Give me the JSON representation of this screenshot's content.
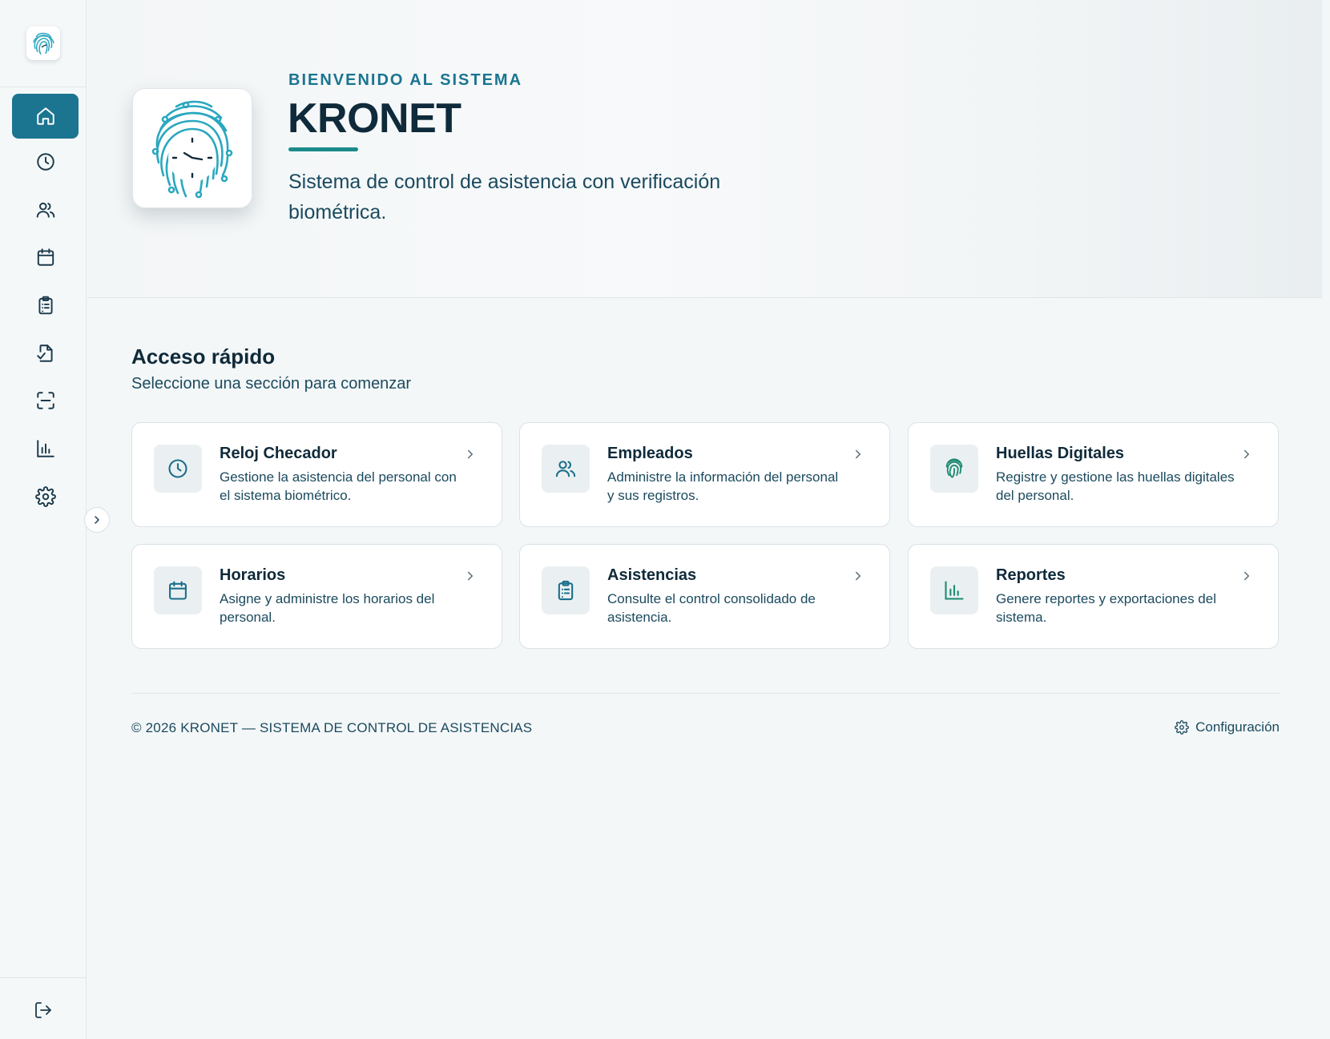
{
  "sidebar": {
    "items": [
      {
        "name": "home-icon",
        "active": true
      },
      {
        "name": "clock-icon",
        "active": false
      },
      {
        "name": "users-icon",
        "active": false
      },
      {
        "name": "calendar-icon",
        "active": false
      },
      {
        "name": "clipboard-icon",
        "active": false
      },
      {
        "name": "file-check-icon",
        "active": false
      },
      {
        "name": "scan-icon",
        "active": false
      },
      {
        "name": "bar-chart-icon",
        "active": false
      },
      {
        "name": "gear-icon",
        "active": false
      }
    ],
    "bottom": {
      "name": "logout-icon"
    },
    "toggle": {
      "name": "chevron-right-icon"
    }
  },
  "hero": {
    "kicker": "BIENVENIDO AL SISTEMA",
    "title": "KRONET",
    "subtitle": "Sistema de control de asistencia con verificación biométrica."
  },
  "quick_access": {
    "title": "Acceso rápido",
    "subtitle": "Seleccione una sección para comenzar",
    "cards": [
      {
        "title": "Reloj Checador",
        "desc": "Gestione la asistencia del personal con el sistema biométrico.",
        "icon": "clock-icon"
      },
      {
        "title": "Empleados",
        "desc": "Administre la información del personal y sus registros.",
        "icon": "users-icon"
      },
      {
        "title": "Huellas Digitales",
        "desc": "Registre y gestione las huellas digitales del personal.",
        "icon": "fingerprint-icon"
      },
      {
        "title": "Horarios",
        "desc": "Asigne y administre los horarios del personal.",
        "icon": "calendar-icon"
      },
      {
        "title": "Asistencias",
        "desc": "Consulte el control consolidado de asistencia.",
        "icon": "clipboard-icon"
      },
      {
        "title": "Reportes",
        "desc": "Genere reportes y exportaciones del sistema.",
        "icon": "bar-chart-icon"
      }
    ]
  },
  "footer": {
    "copyright": "© 2026 KRONET — SISTEMA DE CONTROL DE ASISTENCIAS",
    "config_label": "Configuración"
  },
  "colors": {
    "accent": "#1b7590",
    "accent_teal": "#1b8a8a",
    "text_dark": "#0f2a3a",
    "text_muted": "#1b4a5e",
    "background": "#f4f7f8"
  }
}
